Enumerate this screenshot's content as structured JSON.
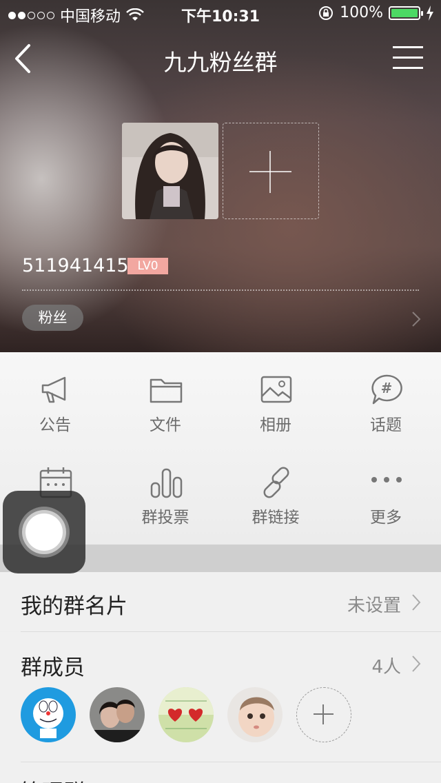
{
  "status_bar": {
    "carrier": "中国移动",
    "time": "下午10:31",
    "battery_text": "100%",
    "battery_color": "#4cd964"
  },
  "header": {
    "title": "九九粉丝群"
  },
  "profile": {
    "group_id": "511941415",
    "level_badge": "LV0",
    "level_badge_color": "#f2a7a0",
    "tag": "粉丝"
  },
  "features": [
    {
      "label": "公告",
      "icon": "megaphone-icon"
    },
    {
      "label": "文件",
      "icon": "folder-icon"
    },
    {
      "label": "相册",
      "icon": "picture-icon"
    },
    {
      "label": "话题",
      "icon": "hashtag-bubble-icon"
    },
    {
      "label": "",
      "icon": "calendar-icon"
    },
    {
      "label": "群投票",
      "icon": "bar-chart-icon"
    },
    {
      "label": "群链接",
      "icon": "link-icon"
    },
    {
      "label": "更多",
      "icon": "more-dots-icon"
    }
  ],
  "settings": {
    "card_label": "我的群名片",
    "card_value": "未设置",
    "members_label": "群成员",
    "members_value": "4人",
    "next_label_partial": "管理群"
  },
  "members": [
    {
      "name": "doraemon-avatar"
    },
    {
      "name": "couple-avatar"
    },
    {
      "name": "hearts-avatar"
    },
    {
      "name": "baby-avatar"
    }
  ]
}
